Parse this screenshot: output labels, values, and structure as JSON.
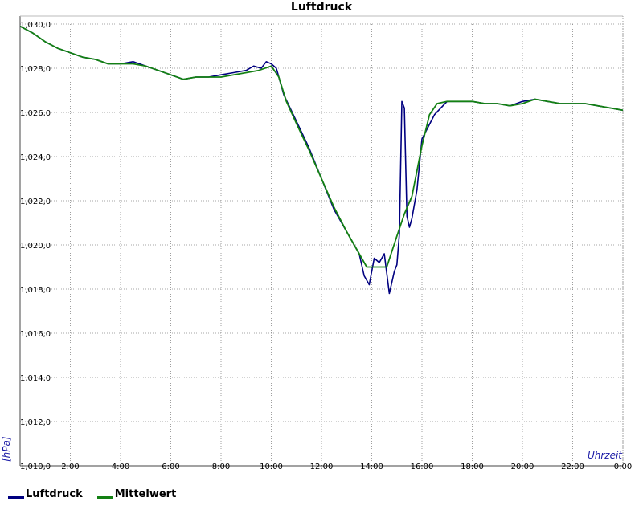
{
  "chart_data": {
    "type": "line",
    "title": "Luftdruck",
    "xlabel": "Uhrzeit",
    "ylabel": "[hPa]",
    "x_unit": "hours",
    "xlim": [
      0,
      24
    ],
    "ylim": [
      1010,
      1030
    ],
    "x_ticks": [
      "2:00",
      "4:00",
      "6:00",
      "8:00",
      "10:00",
      "12:00",
      "14:00",
      "16:00",
      "18:00",
      "20:00",
      "22:00",
      "0:00"
    ],
    "y_ticks": [
      "1,010,0",
      "1,012,0",
      "1,014,0",
      "1,016,0",
      "1,018,0",
      "1,020,0",
      "1,022,0",
      "1,024,0",
      "1,026,0",
      "1,028,0",
      "1,030,0"
    ],
    "grid": true,
    "legend_position": "bottom-left",
    "series": [
      {
        "name": "Luftdruck",
        "color": "#000080",
        "x": [
          0,
          0.5,
          1,
          1.5,
          2,
          2.5,
          3,
          3.5,
          4,
          4.5,
          5,
          5.5,
          6,
          6.5,
          7,
          7.5,
          8,
          8.5,
          9,
          9.3,
          9.6,
          9.8,
          10.0,
          10.2,
          10.5,
          11.0,
          11.5,
          12.0,
          12.5,
          13.0,
          13.5,
          13.7,
          13.9,
          14.1,
          14.3,
          14.5,
          14.7,
          14.9,
          15.0,
          15.1,
          15.2,
          15.3,
          15.4,
          15.5,
          15.6,
          15.8,
          16.0,
          16.5,
          17.0,
          17.5,
          18.0,
          18.5,
          19.0,
          19.5,
          20.0,
          20.5,
          21.0,
          21.5,
          22.0,
          22.5,
          23.0,
          23.5,
          24.0
        ],
        "y": [
          1029.9,
          1029.6,
          1029.2,
          1028.9,
          1028.7,
          1028.5,
          1028.4,
          1028.2,
          1028.2,
          1028.3,
          1028.1,
          1027.9,
          1027.7,
          1027.5,
          1027.6,
          1027.6,
          1027.7,
          1027.8,
          1027.9,
          1028.1,
          1028.0,
          1028.3,
          1028.2,
          1028.0,
          1026.8,
          1025.6,
          1024.4,
          1023.0,
          1021.6,
          1020.6,
          1019.6,
          1018.6,
          1018.2,
          1019.4,
          1019.2,
          1019.6,
          1017.8,
          1018.8,
          1019.1,
          1020.5,
          1026.5,
          1026.2,
          1021.3,
          1020.8,
          1021.2,
          1022.5,
          1024.8,
          1025.9,
          1026.5,
          1026.5,
          1026.5,
          1026.4,
          1026.4,
          1026.3,
          1026.5,
          1026.6,
          1026.5,
          1026.4,
          1026.4,
          1026.4,
          1026.3,
          1026.2,
          1026.1
        ]
      },
      {
        "name": "Mittelwert",
        "color": "#138013",
        "x": [
          0,
          0.5,
          1,
          1.5,
          2,
          2.5,
          3,
          3.5,
          4,
          4.5,
          5,
          5.5,
          6,
          6.5,
          7,
          7.5,
          8,
          8.5,
          9,
          9.5,
          10.0,
          10.3,
          10.6,
          11.0,
          11.5,
          12.0,
          12.5,
          13.0,
          13.5,
          13.8,
          14.0,
          14.3,
          14.6,
          15.0,
          15.3,
          15.6,
          16.0,
          16.3,
          16.6,
          17.0,
          17.5,
          18.0,
          18.5,
          19.0,
          19.5,
          20.0,
          20.5,
          21.0,
          21.5,
          22.0,
          22.5,
          23.0,
          23.5,
          24.0
        ],
        "y": [
          1029.9,
          1029.6,
          1029.2,
          1028.9,
          1028.7,
          1028.5,
          1028.4,
          1028.2,
          1028.2,
          1028.2,
          1028.1,
          1027.9,
          1027.7,
          1027.5,
          1027.6,
          1027.6,
          1027.6,
          1027.7,
          1027.8,
          1027.9,
          1028.1,
          1027.6,
          1026.5,
          1025.5,
          1024.3,
          1023.0,
          1021.7,
          1020.6,
          1019.6,
          1019.0,
          1019.0,
          1019.0,
          1019.0,
          1020.4,
          1021.4,
          1022.2,
          1024.5,
          1025.9,
          1026.4,
          1026.5,
          1026.5,
          1026.5,
          1026.4,
          1026.4,
          1026.3,
          1026.4,
          1026.6,
          1026.5,
          1026.4,
          1026.4,
          1026.4,
          1026.3,
          1026.2,
          1026.1
        ]
      }
    ]
  }
}
